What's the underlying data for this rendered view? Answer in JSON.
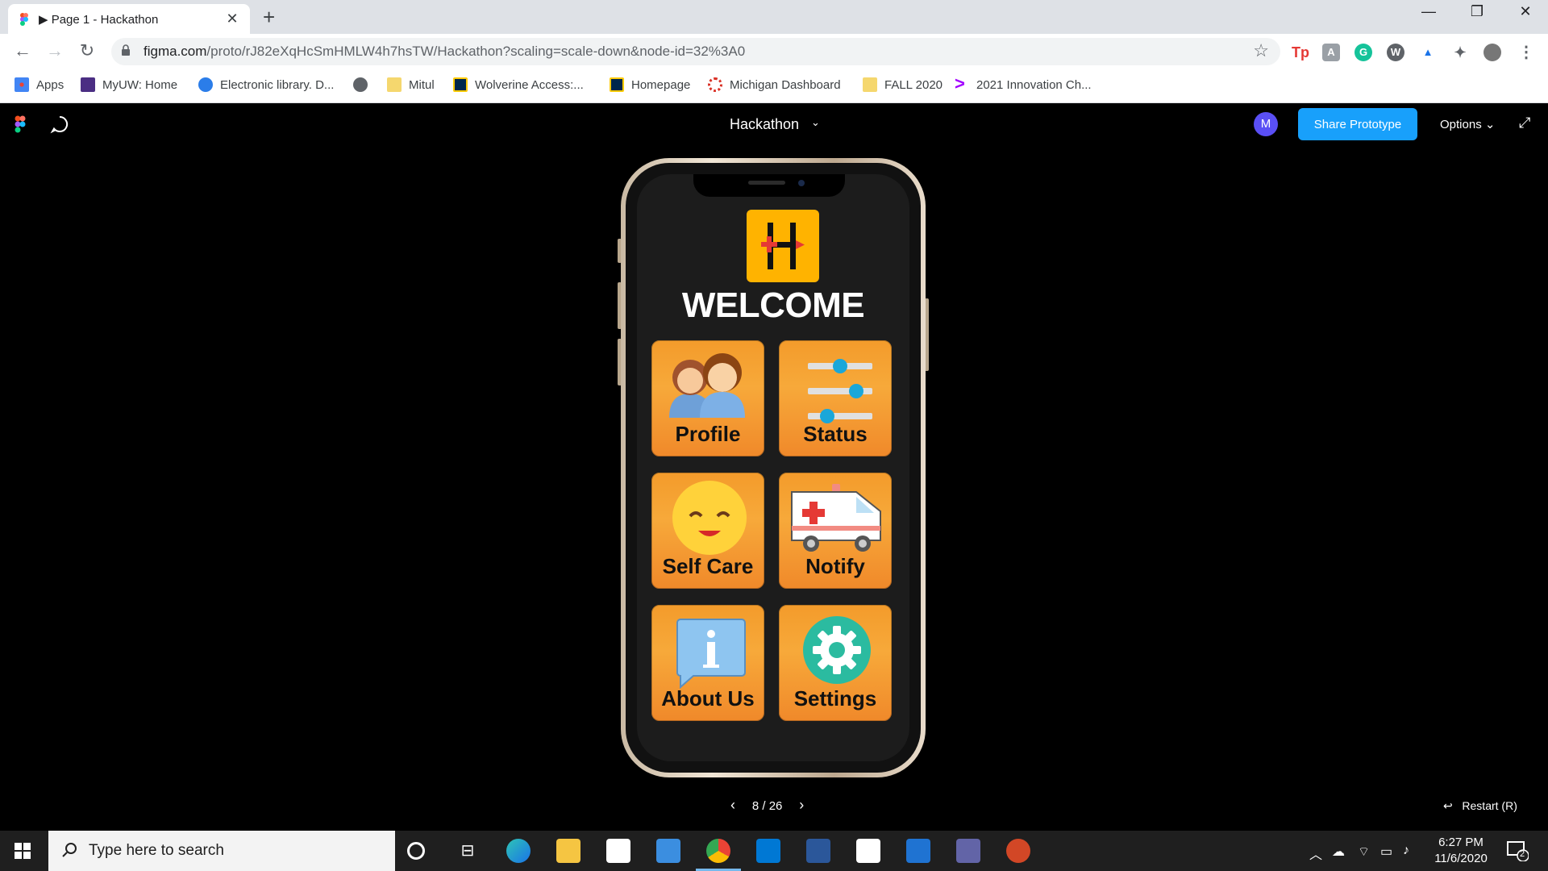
{
  "browser": {
    "tab_title": "▶ Page 1 - Hackathon",
    "tab_close": "✕",
    "new_tab": "+",
    "url_host": "figma.com",
    "url_path": "/proto/rJ82eXqHcSmHMLW4h7hsTW/Hackathon?scaling=scale-down&node-id=32%3A0",
    "window_controls": {
      "minimize": "—",
      "restore": "❐",
      "close": "✕"
    }
  },
  "bookmarks": [
    {
      "label": "Apps",
      "icon": "apps-grid-icon",
      "color": "#4285f4"
    },
    {
      "label": "MyUW: Home",
      "icon": "myuw-icon",
      "color": "#4b2e83"
    },
    {
      "label": "Electronic library. D...",
      "icon": "globe-blue-icon",
      "color": "#2b7de9"
    },
    {
      "label": "",
      "icon": "globe-icon",
      "color": "#5f6368"
    },
    {
      "label": "Mitul",
      "icon": "folder-icon",
      "color": "#f5d76e"
    },
    {
      "label": "Wolverine Access:...",
      "icon": "michigan-icon",
      "color": "#00274c"
    },
    {
      "label": "Homepage",
      "icon": "michigan-icon",
      "color": "#00274c"
    },
    {
      "label": "Michigan Dashboard",
      "icon": "dashboard-icon",
      "color": "#d93025"
    },
    {
      "label": "FALL 2020",
      "icon": "folder-icon",
      "color": "#f5d76e"
    },
    {
      "label": "2021 Innovation Ch...",
      "icon": "accenture-icon",
      "color": "#a100ff"
    }
  ],
  "figma": {
    "project_title": "Hackathon",
    "avatar_initial": "M",
    "share_label": "Share Prototype",
    "options_label": "Options",
    "pager": "8 / 26",
    "restart_label": "Restart (R)"
  },
  "app": {
    "welcome": "WELCOME",
    "tiles": [
      {
        "label": "Profile",
        "icon": "profile-people-icon"
      },
      {
        "label": "Status",
        "icon": "status-sliders-icon"
      },
      {
        "label": "Self Care",
        "icon": "self-care-smiley-icon"
      },
      {
        "label": "Notify",
        "icon": "ambulance-icon"
      },
      {
        "label": "About Us",
        "icon": "info-bubble-icon"
      },
      {
        "label": "Settings",
        "icon": "gear-icon"
      }
    ],
    "colors": {
      "tile": "#f39b2b",
      "logo": "#ffb300",
      "screen": "#1c1c1c"
    }
  },
  "taskbar": {
    "search_placeholder": "Type here to search",
    "time": "6:27 PM",
    "date": "11/6/2020",
    "notification_count": "2"
  }
}
